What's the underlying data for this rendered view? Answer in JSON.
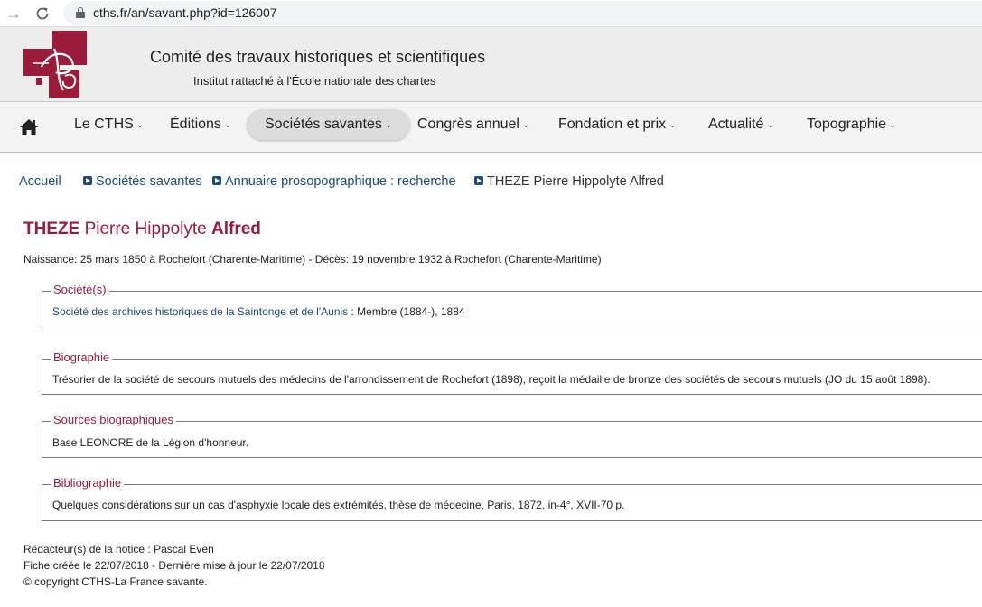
{
  "browser": {
    "url": "cths.fr/an/savant.php?id=126007"
  },
  "header": {
    "title": "Comité des travaux historiques et scientifiques",
    "subtitle": "Institut rattaché à l'École nationale des chartes",
    "logo_color": "#9b1b3b"
  },
  "nav": {
    "items": [
      {
        "label": "Le CTHS"
      },
      {
        "label": "Éditions"
      },
      {
        "label": "Sociétés savantes"
      },
      {
        "label": "Congrès annuel"
      },
      {
        "label": "Fondation et prix"
      },
      {
        "label": "Actualité"
      },
      {
        "label": "Topographie"
      }
    ],
    "active": "Sociétés savantes"
  },
  "breadcrumb": {
    "home": "Accueil",
    "items": [
      "Sociétés savantes",
      "Annuaire prosopographique : recherche"
    ],
    "current": "THEZE Pierre Hippolyte Alfred"
  },
  "person": {
    "surname": "THEZE",
    "given_names": "Pierre Hippolyte",
    "usual_name": "Alfred",
    "life": "Naissance: 25 mars 1850 à Rochefort (Charente-Maritime) - Décès: 19 novembre 1932 à Rochefort (Charente-Maritime)"
  },
  "sections": {
    "societes": {
      "legend": "Société(s)",
      "society_link": "Société des archives historiques de la Saintonge et de l'Aunis",
      "detail": " : Membre (1884-), 1884"
    },
    "biographie": {
      "legend": "Biographie",
      "text": "Trésorier de la société de secours mutuels des médecins de l'arrondissement de Rochefort (1898), reçoit la médaille de bronze des sociétés de secours mutuels (JO du 15 août 1898)."
    },
    "sources": {
      "legend": "Sources biographiques",
      "text": "Base LEONORE de la Légion d'honneur."
    },
    "bibliographie": {
      "legend": "Bibliographie",
      "text": "Quelques considérations sur un cas d'asphyxie locale des extrémités, thèse de médecine, Paris, 1872, in-4°, XVII-70 p."
    }
  },
  "footer": {
    "redacteur": "Rédacteur(s) de la notice : Pascal Even",
    "dates": "Fiche créée le 22/07/2018 - Dernière mise à jour le 22/07/2018",
    "copyright": "© copyright CTHS-La France savante."
  }
}
